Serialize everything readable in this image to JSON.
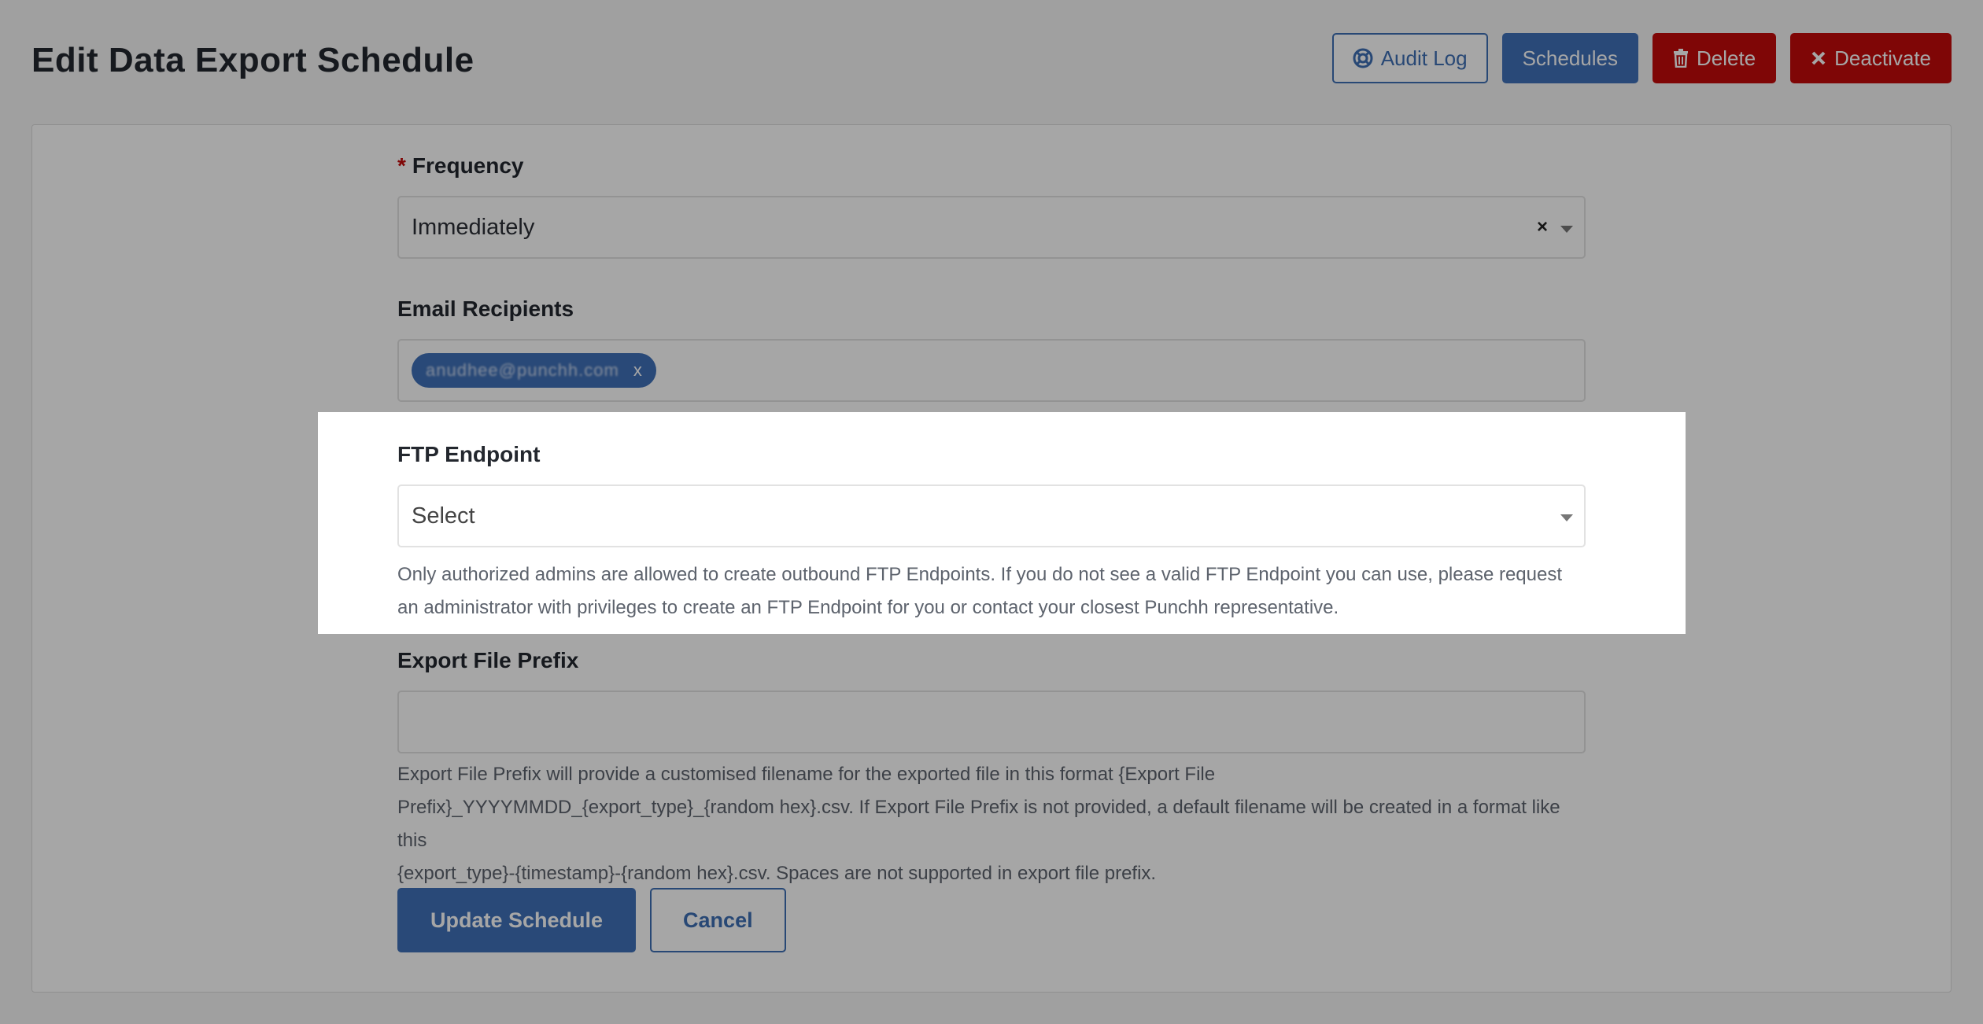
{
  "page": {
    "title": "Edit Data Export Schedule"
  },
  "header_actions": {
    "audit_log_label": "Audit Log",
    "schedules_label": "Schedules",
    "delete_label": "Delete",
    "deactivate_label": "Deactivate",
    "audit_log_icon": "lifebuoy-icon",
    "delete_icon": "trash-icon",
    "deactivate_icon": "close-icon"
  },
  "form": {
    "frequency": {
      "required_marker": "*",
      "label": "Frequency",
      "value": "Immediately",
      "clear_symbol": "×"
    },
    "email_recipients": {
      "label": "Email Recipients",
      "tags": [
        {
          "text": "anudhee@punchh.com",
          "remove_symbol": "x"
        }
      ]
    },
    "ftp_endpoint": {
      "label": "FTP Endpoint",
      "placeholder": "Select",
      "help": "Only authorized admins are allowed to create outbound FTP Endpoints. If you do not see a valid FTP Endpoint you can use, please request an administrator with privileges to create an FTP Endpoint for you or contact your closest Punchh representative."
    },
    "export_file_prefix": {
      "label": "Export File Prefix",
      "value": "",
      "help_line1": "Export File Prefix will provide a customised filename for the exported file in this format {Export File",
      "help_line2": "Prefix}_YYYYMMDD_{export_type}_{random hex}.csv. If Export File Prefix is not provided, a default filename will be created in a format like this",
      "help_line3": "{export_type}-{timestamp}-{random hex}.csv. Spaces are not supported in export file prefix."
    },
    "submit_label": "Update Schedule",
    "cancel_label": "Cancel"
  },
  "colors": {
    "primary": "#3f70b8",
    "danger": "#c40a0a",
    "overlay": "rgba(0,0,0,0.35)"
  }
}
